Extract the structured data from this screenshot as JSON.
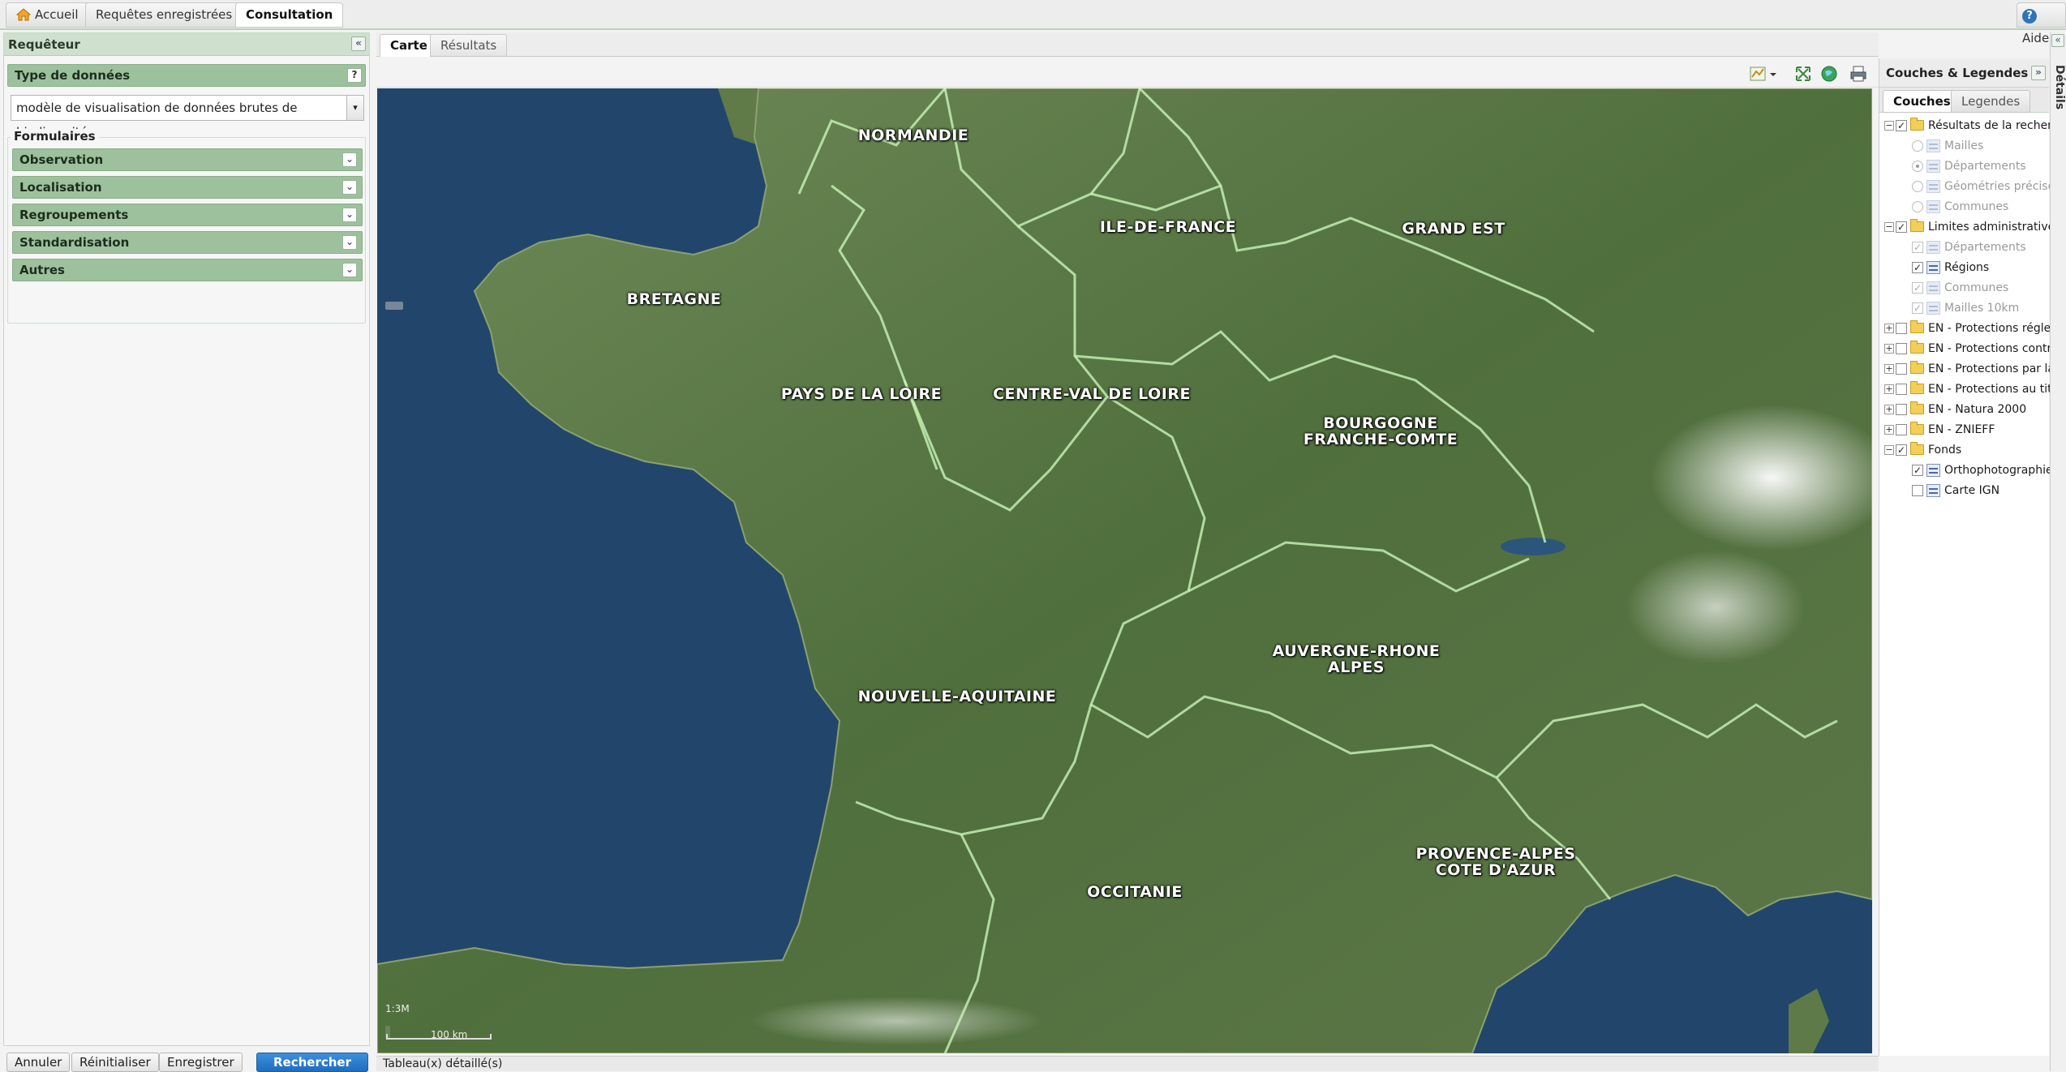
{
  "top_tabs": {
    "home": "Accueil",
    "saved": "Requêtes enregistrées",
    "consultation": "Consultation",
    "help": "Aide"
  },
  "left": {
    "title": "Requêteur",
    "data_type_label": "Type de données",
    "help_mark": "?",
    "data_type_value": "modèle de visualisation de données brutes de biodiversité",
    "forms_legend": "Formulaires",
    "forms": [
      "Observation",
      "Localisation",
      "Regroupements",
      "Standardisation",
      "Autres"
    ],
    "buttons": {
      "cancel": "Annuler",
      "reset": "Réinitialiser",
      "save": "Enregistrer",
      "search": "Rechercher"
    }
  },
  "center": {
    "tabs": [
      "Carte",
      "Résultats"
    ],
    "bottom_strip": "Tableau(x) détaillé(s)"
  },
  "map": {
    "regions": [
      "NORMANDIE",
      "ILE-DE-FRANCE",
      "GRAND EST",
      "BRETAGNE",
      "PAYS DE LA LOIRE",
      "CENTRE-VAL DE LOIRE",
      "BOURGOGNE\nFRANCHE-COMTE",
      "NOUVELLE-AQUITAINE",
      "AUVERGNE-RHONE\nALPES",
      "PROVENCE-ALPES\nCOTE D'AZUR",
      "OCCITANIE"
    ],
    "scale_ratio": "1:3M",
    "scale_bar": "100 km",
    "colors": {
      "sea": "#22466b",
      "land": "#5b7a45",
      "border": "#c9f5b8"
    }
  },
  "right": {
    "title": "Couches & Legendes",
    "tabs": [
      "Couches",
      "Legendes"
    ],
    "tree": [
      {
        "label": "Résultats de la recherch",
        "type": "folder",
        "checked": true
      },
      {
        "label": "Mailles",
        "type": "radio",
        "disabled": true
      },
      {
        "label": "Départements",
        "type": "radio",
        "disabled": true,
        "selected": true
      },
      {
        "label": "Géométries précises",
        "type": "radio",
        "disabled": true
      },
      {
        "label": "Communes",
        "type": "radio",
        "disabled": true
      },
      {
        "label": "Limites administratives",
        "type": "folder",
        "checked": true
      },
      {
        "label": "Départements",
        "type": "layer",
        "checked": true,
        "disabled": true
      },
      {
        "label": "Régions",
        "type": "layer",
        "checked": true
      },
      {
        "label": "Communes",
        "type": "layer",
        "checked": true,
        "disabled": true
      },
      {
        "label": "Mailles 10km",
        "type": "layer",
        "checked": true,
        "disabled": true
      },
      {
        "label": "EN - Protections réglemen",
        "type": "folder-closed"
      },
      {
        "label": "EN - Protections contrac",
        "type": "folder-closed"
      },
      {
        "label": "EN - Protections par la m",
        "type": "folder-closed"
      },
      {
        "label": "EN - Protections au titre",
        "type": "folder-closed"
      },
      {
        "label": "EN - Natura 2000",
        "type": "folder-closed"
      },
      {
        "label": "EN - ZNIEFF",
        "type": "folder-closed"
      },
      {
        "label": "Fonds",
        "type": "folder",
        "checked": true
      },
      {
        "label": "Orthophotographies",
        "type": "layer",
        "checked": true
      },
      {
        "label": "Carte IGN",
        "type": "layer",
        "checked": false
      }
    ]
  },
  "details_label": "Détails"
}
